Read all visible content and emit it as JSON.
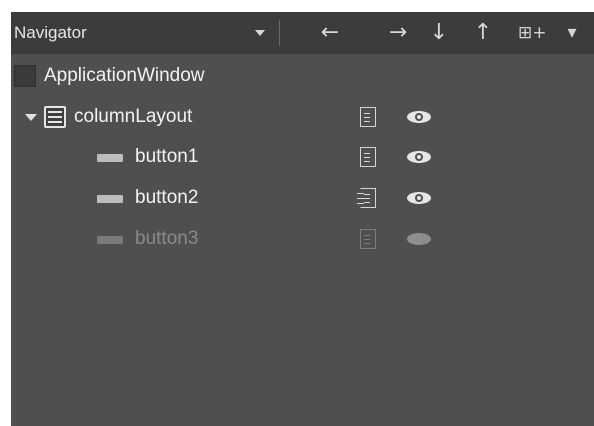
{
  "navigator": {
    "title": "Navigator",
    "toolbar": {
      "move_left_icon": "←",
      "move_right_icon": "→",
      "move_down_icon": "↓",
      "move_up_icon": "↑",
      "filter_icon": "⊞+",
      "menu_icon": "▾"
    }
  },
  "tree": [
    {
      "label": "ApplicationWindow",
      "type": "root"
    },
    {
      "label": "columnLayout",
      "type": "layout",
      "expanded": true,
      "exported": false,
      "visible": true
    },
    {
      "label": "button1",
      "type": "button",
      "exported": false,
      "visible": true
    },
    {
      "label": "button2",
      "type": "button",
      "exported": true,
      "visible": true
    },
    {
      "label": "button3",
      "type": "button",
      "exported": false,
      "visible": false
    }
  ],
  "colors": {
    "panel_bg": "#4f4f4f",
    "toolbar_bg": "#3c3c3c",
    "text": "#f2f2f2",
    "disabled_text": "#8a8a8a"
  }
}
